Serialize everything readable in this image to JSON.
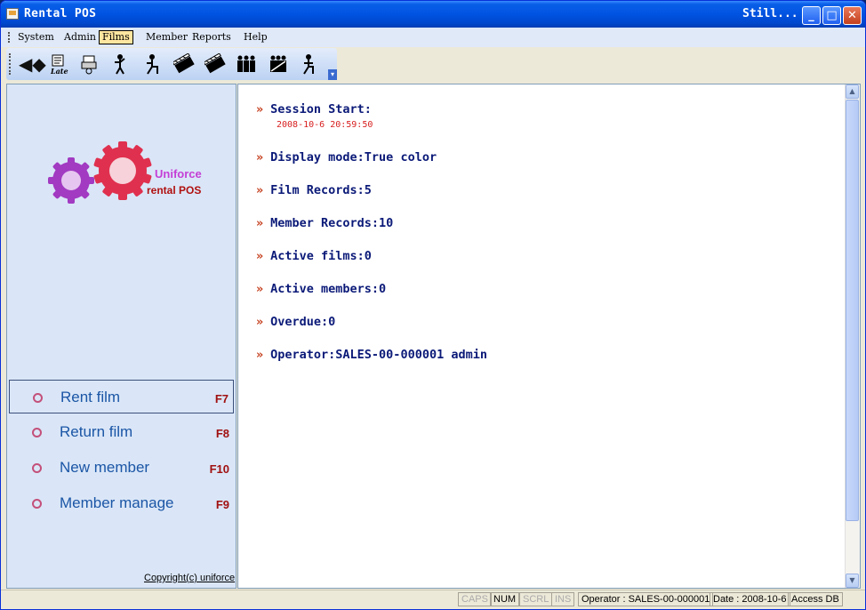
{
  "window": {
    "title": "Rental POS",
    "title_right": "Still...",
    "minimize": "_",
    "maximize": "□",
    "close": "✕"
  },
  "menu": [
    {
      "label": "System",
      "active": false
    },
    {
      "label": "Admin",
      "active": false
    },
    {
      "label": "Films",
      "active": true
    },
    {
      "label": "Member",
      "active": false
    },
    {
      "label": "Reports",
      "active": false
    },
    {
      "label": "Help",
      "active": false
    }
  ],
  "toolbar": {
    "icons": [
      "back-icon",
      "late-icon",
      "printer-icon",
      "person-icon",
      "seated-person-icon",
      "film-clapper-icon",
      "film-clapper-return-icon",
      "group-icon",
      "group-manage-icon",
      "operator-icon"
    ],
    "late_label": "Late"
  },
  "logo": {
    "brand": "Uniforce",
    "product": "rental POS",
    "gear_colors": [
      "#a23ac2",
      "#e0304f"
    ]
  },
  "actions": [
    {
      "label": "Rent film",
      "key": "F7",
      "selected": true
    },
    {
      "label": "Return film",
      "key": "F8",
      "selected": false
    },
    {
      "label": "New member",
      "key": "F10",
      "selected": false
    },
    {
      "label": "Member manage",
      "key": "F9",
      "selected": false
    }
  ],
  "copyright": "Copyright(c) uniforce",
  "info": {
    "session_start": "Session Start:",
    "session_time": "2008-10-6  20:59:50",
    "lines": [
      "Display mode:True color",
      "Film Records:5",
      "Member Records:10",
      "Active films:0",
      "Active members:0",
      "Overdue:0",
      "Operator:SALES-00-000001 admin"
    ]
  },
  "status": {
    "caps": "CAPS",
    "num": "NUM",
    "scrl": "SCRL",
    "ins": "INS",
    "operator": "Operator : SALES-00-000001",
    "date": "Date : 2008-10-6",
    "db": "Access DB"
  },
  "colors": {
    "accent": "#1b56a6",
    "chevron": "#c43b19",
    "hotkey": "#a01010",
    "info_text": "#0b1a78"
  }
}
